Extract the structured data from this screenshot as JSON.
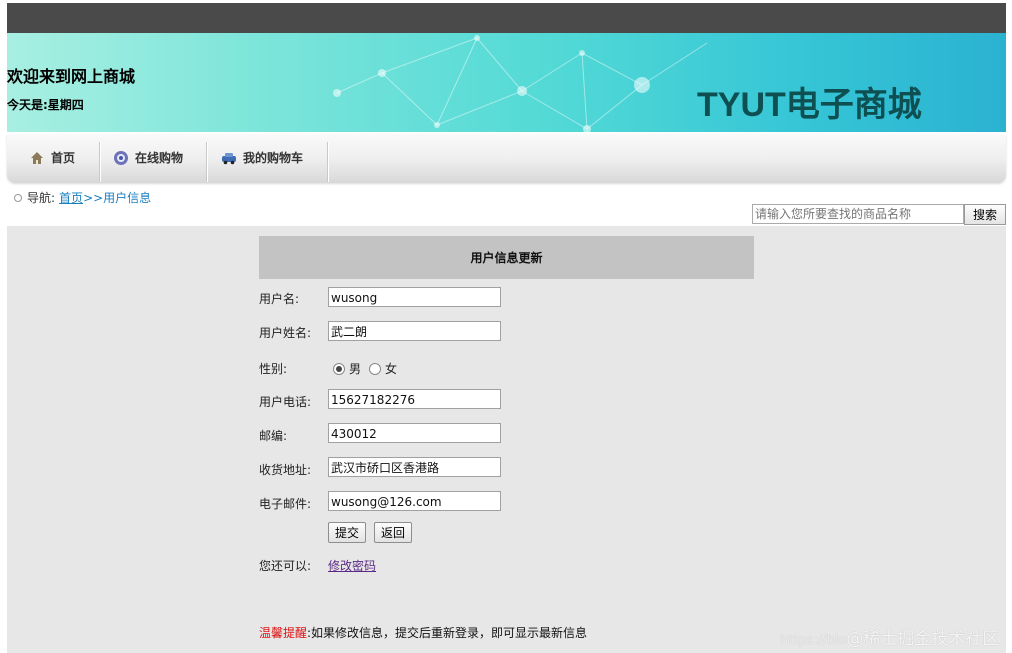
{
  "header": {
    "welcome": "欢迎来到网上商城",
    "today": "今天是:星期四",
    "brand": "TYUT电子商城"
  },
  "nav": {
    "items": [
      {
        "label": "首页",
        "icon": "home-icon"
      },
      {
        "label": "在线购物",
        "icon": "browser-icon"
      },
      {
        "label": "我的购物车",
        "icon": "car-icon"
      }
    ]
  },
  "breadcrumb": {
    "prefix": "导航:",
    "home": "首页",
    "current": ">>用户信息"
  },
  "search": {
    "placeholder": "请输入您所要查找的商品名称",
    "button": "搜索"
  },
  "form": {
    "title": "用户信息更新",
    "labels": {
      "username": "用户名:",
      "realname": "用户姓名:",
      "gender": "性别:",
      "phone": "用户电话:",
      "zip": "邮编:",
      "address": "收货地址:",
      "email": "电子邮件:",
      "more": "您还可以:"
    },
    "values": {
      "username": "wusong",
      "realname": "武二朗",
      "phone": "15627182276",
      "zip": "430012",
      "address": "武汉市硚口区香港路",
      "email": "wusong@126.com"
    },
    "gender_options": [
      "男",
      "女"
    ],
    "gender_selected": "男",
    "submit": "提交",
    "back": "返回",
    "change_password": "修改密码"
  },
  "tip": {
    "label": "温馨提醒",
    "text": ":如果修改信息，提交后重新登录，即可显示最新信息"
  },
  "watermark": {
    "url": "https://blo",
    "text": "@稀土掘金技术社区"
  },
  "colors": {
    "brand": "#0e4f52",
    "link": "#1a7fc1",
    "tip_label": "#dd1111",
    "main_bg": "#e8e7e7",
    "form_header_bg": "#c3c3c3"
  }
}
